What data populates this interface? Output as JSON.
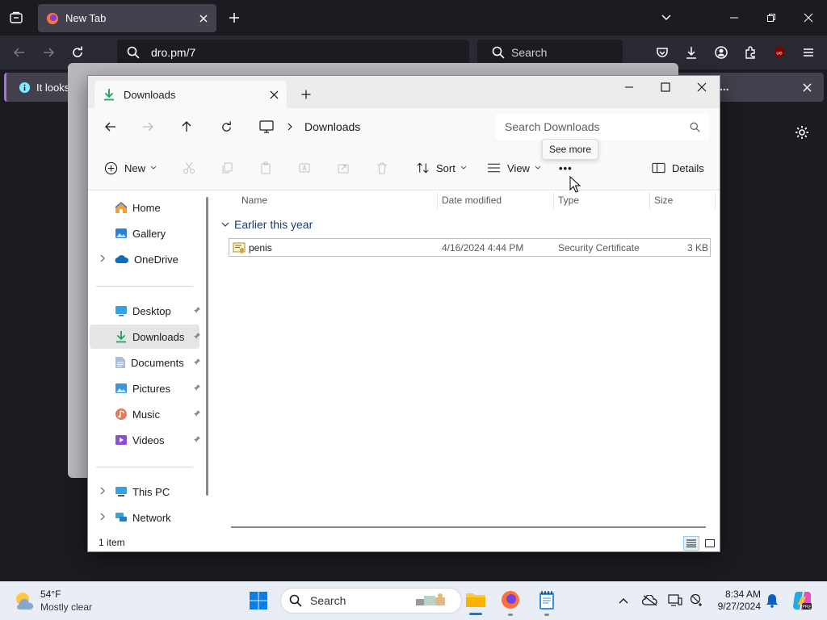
{
  "firefox": {
    "tab_title": "New Tab",
    "url": "dro.pm/7",
    "search_placeholder": "Search",
    "notification_text": "It looks",
    "notification_more": "...",
    "accent_color": "#b26ddf"
  },
  "explorer": {
    "tab_title": "Downloads",
    "breadcrumb": "Downloads",
    "search_placeholder": "Search Downloads",
    "tooltip": "See more",
    "commands": {
      "new": "New",
      "sort": "Sort",
      "view": "View",
      "more": "•••",
      "details": "Details"
    },
    "nav": [
      {
        "label": "Home",
        "icon": "home-icon"
      },
      {
        "label": "Gallery",
        "icon": "gallery-icon"
      },
      {
        "label": "OneDrive",
        "icon": "onedrive-icon"
      },
      {
        "label": "Desktop",
        "icon": "desktop-icon"
      },
      {
        "label": "Downloads",
        "icon": "downloads-icon"
      },
      {
        "label": "Documents",
        "icon": "documents-icon"
      },
      {
        "label": "Pictures",
        "icon": "pictures-icon"
      },
      {
        "label": "Music",
        "icon": "music-icon"
      },
      {
        "label": "Videos",
        "icon": "videos-icon"
      },
      {
        "label": "This PC",
        "icon": "this-pc-icon"
      },
      {
        "label": "Network",
        "icon": "network-icon"
      }
    ],
    "columns": [
      "Name",
      "Date modified",
      "Type",
      "Size"
    ],
    "group_label": "Earlier this year",
    "files": [
      {
        "name": "penis",
        "date": "4/16/2024 4:44 PM",
        "type": "Security Certificate",
        "size": "3 KB"
      }
    ],
    "status": "1 item"
  },
  "taskbar": {
    "weather_temp": "54°F",
    "weather_desc": "Mostly clear",
    "search_placeholder": "Search",
    "time": "8:34 AM",
    "date": "9/27/2024"
  }
}
